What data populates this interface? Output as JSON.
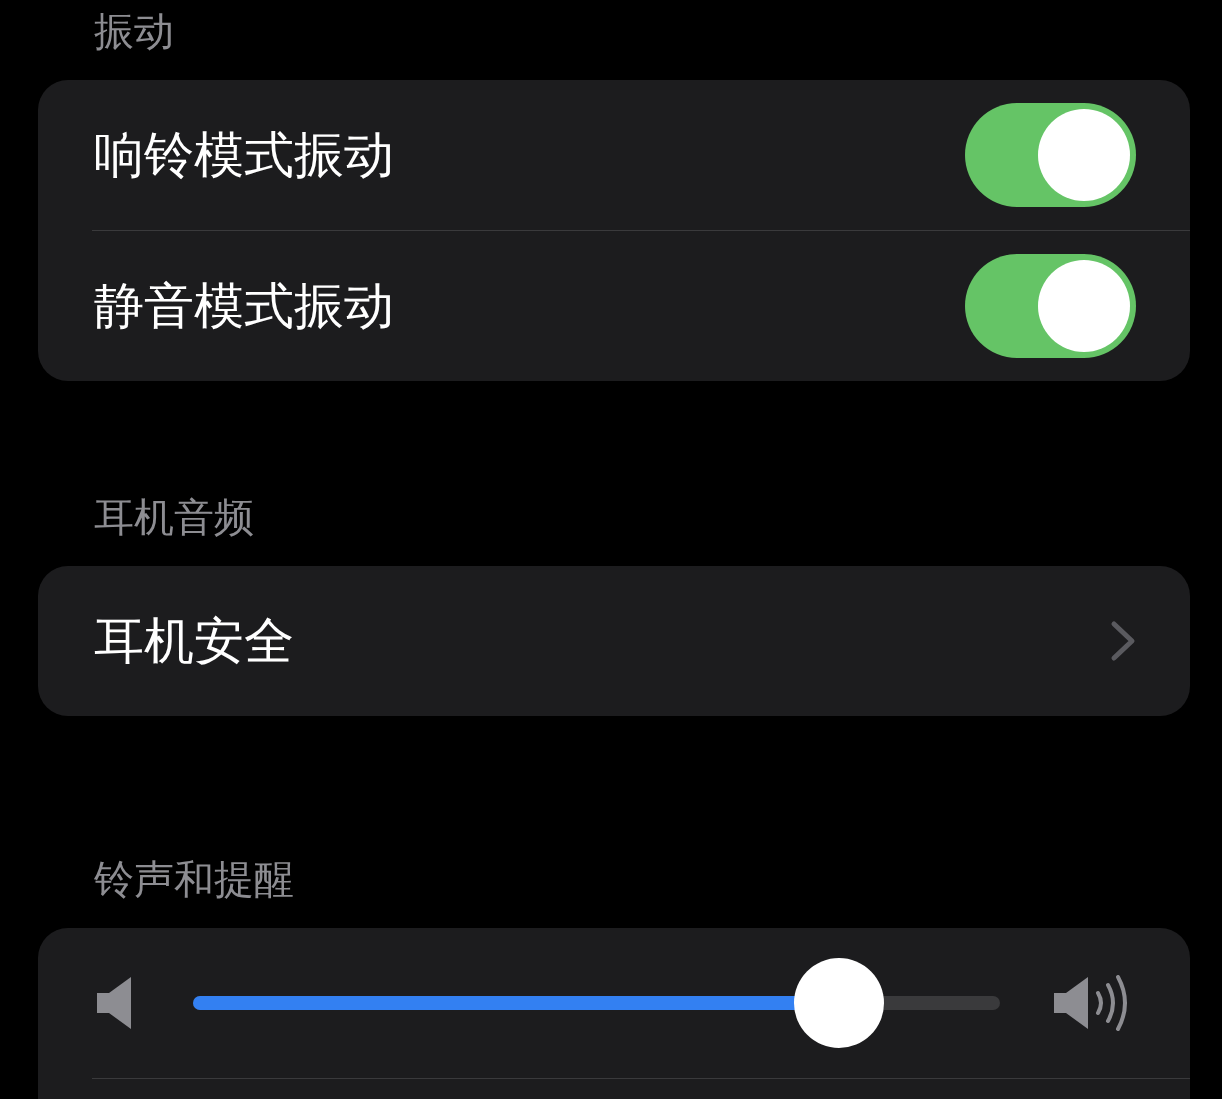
{
  "sections": [
    {
      "header": "振动",
      "rows": [
        {
          "kind": "toggle",
          "label": "响铃模式振动",
          "on": true
        },
        {
          "kind": "toggle",
          "label": "静音模式振动",
          "on": true
        }
      ]
    },
    {
      "header": "耳机音频",
      "rows": [
        {
          "kind": "link",
          "label": "耳机安全"
        }
      ]
    },
    {
      "header": "铃声和提醒",
      "rows": [
        {
          "kind": "slider",
          "level": 0.8
        }
      ]
    }
  ]
}
